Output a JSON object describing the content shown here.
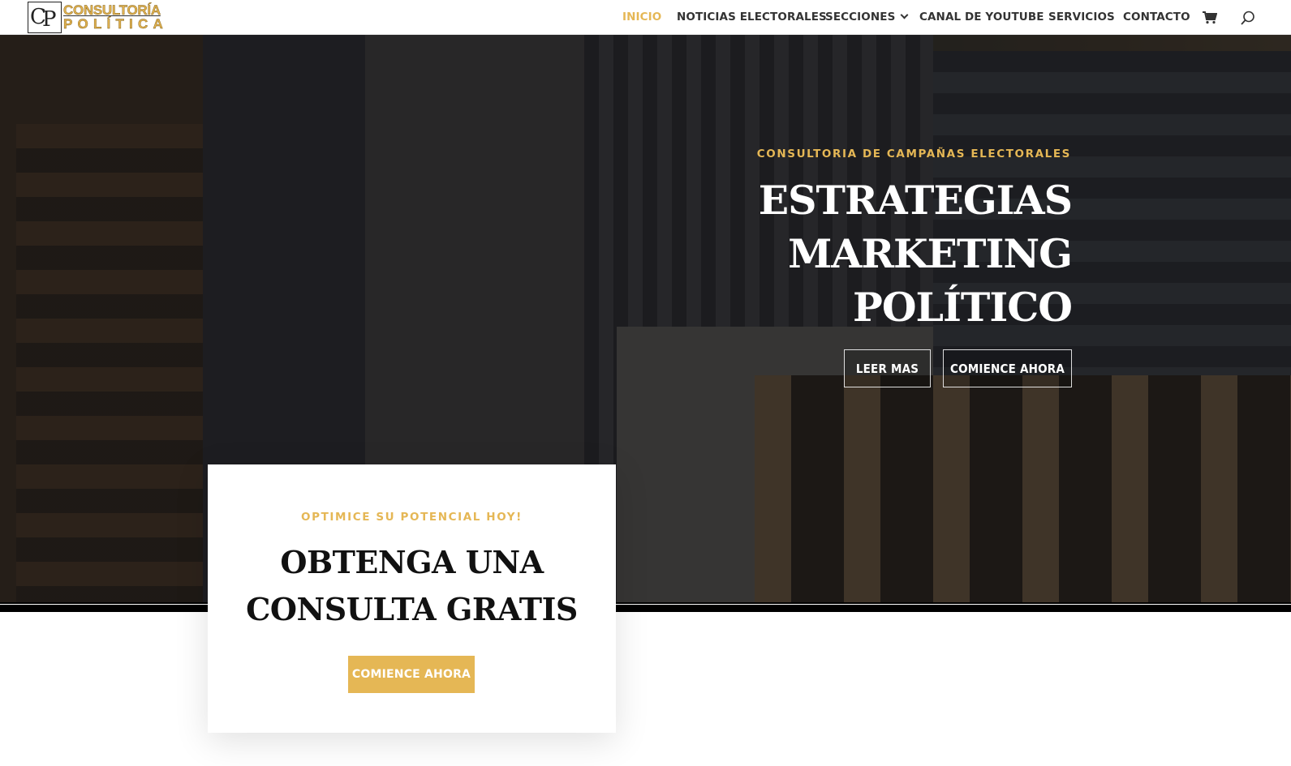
{
  "header": {
    "logo_mark": "CP",
    "logo_line1": "CONSULTORÍA",
    "logo_line2": "POLÍTICA",
    "nav": [
      {
        "label": "INICIO",
        "active": true
      },
      {
        "label": "NOTICIAS ELECTORALES",
        "active": false
      },
      {
        "label": "SECCIONES",
        "active": false,
        "has_dropdown": true
      },
      {
        "label": "CANAL DE YOUTUBE",
        "active": false
      },
      {
        "label": "SERVICIOS",
        "active": false
      },
      {
        "label": "CONTACTO",
        "active": false
      }
    ],
    "icons": [
      "cart-icon",
      "search-icon"
    ]
  },
  "hero": {
    "eyebrow": "CONSULTORIA DE CAMPAÑAS ELECTORALES",
    "title_lines": [
      "ESTRATEGIAS",
      "MARKETING",
      "POLÍTICO"
    ],
    "button_primary": "LEER MAS",
    "button_secondary": "COMIENCE AHORA"
  },
  "card": {
    "eyebrow": "OPTIMICE SU POTENCIAL HOY!",
    "title_lines": [
      "OBTENGA UNA",
      "CONSULTA GRATIS"
    ],
    "button": "COMIENCE AHORA"
  },
  "colors": {
    "accent": "#e5b755",
    "text_dark": "#333333",
    "white": "#ffffff"
  }
}
